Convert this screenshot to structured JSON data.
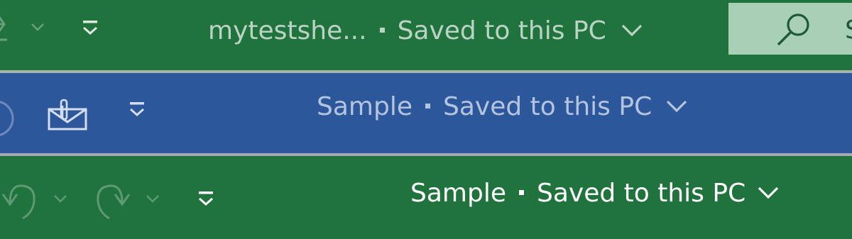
{
  "excel_toolbar_1": {
    "file_name": "mytestshe...",
    "save_status": "Saved to this PC",
    "search_partial_letter": "S",
    "icons": [
      "redo-partial-icon",
      "dropdown-chevron-icon",
      "customize-qat-icon",
      "title-chevron-down-icon",
      "search-icon"
    ]
  },
  "word_toolbar": {
    "file_name": "Sample",
    "save_status": "Saved to this PC",
    "icons": [
      "circle-partial-icon",
      "email-attachment-icon",
      "customize-qat-icon",
      "title-chevron-down-icon"
    ]
  },
  "excel_toolbar_2": {
    "file_name": "Sample",
    "save_status": "Saved to this PC",
    "icons": [
      "undo-icon",
      "undo-dropdown-icon",
      "redo-icon",
      "redo-dropdown-icon",
      "customize-qat-icon",
      "title-chevron-down-icon"
    ]
  },
  "colors": {
    "excel_green": "#21733e",
    "word_blue": "#2c579a",
    "search_box": "#a8d0b6"
  }
}
